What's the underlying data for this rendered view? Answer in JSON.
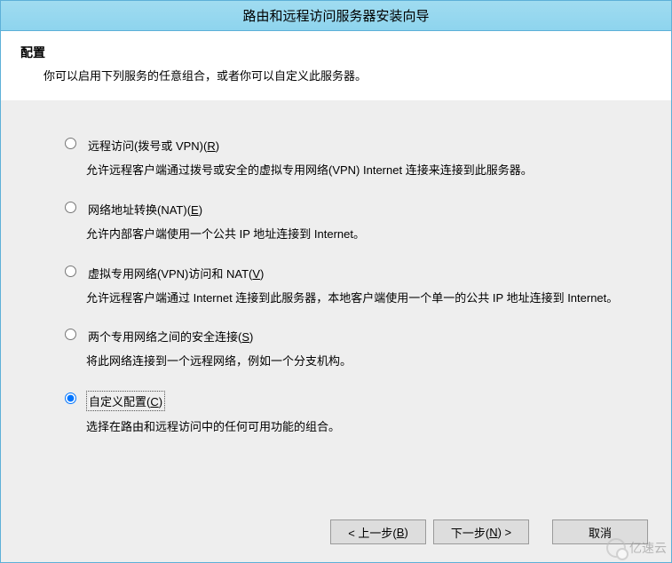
{
  "title": "路由和远程访问服务器安装向导",
  "header": {
    "title": "配置",
    "desc": "你可以启用下列服务的任意组合，或者你可以自定义此服务器。"
  },
  "options": [
    {
      "label_pre": "远程访问(拨号或 VPN)(",
      "hotkey": "R",
      "label_post": ")",
      "desc": "允许远程客户端通过拨号或安全的虚拟专用网络(VPN) Internet 连接来连接到此服务器。",
      "selected": false
    },
    {
      "label_pre": "网络地址转换(NAT)(",
      "hotkey": "E",
      "label_post": ")",
      "desc": "允许内部客户端使用一个公共 IP 地址连接到 Internet。",
      "selected": false
    },
    {
      "label_pre": "虚拟专用网络(VPN)访问和 NAT(",
      "hotkey": "V",
      "label_post": ")",
      "desc": "允许远程客户端通过 Internet 连接到此服务器，本地客户端使用一个单一的公共 IP 地址连接到 Internet。",
      "selected": false
    },
    {
      "label_pre": "两个专用网络之间的安全连接(",
      "hotkey": "S",
      "label_post": ")",
      "desc": "将此网络连接到一个远程网络，例如一个分支机构。",
      "selected": false
    },
    {
      "label_pre": "自定义配置(",
      "hotkey": "C",
      "label_post": ")",
      "desc": "选择在路由和远程访问中的任何可用功能的组合。",
      "selected": true
    }
  ],
  "buttons": {
    "back_pre": "< 上一步(",
    "back_hotkey": "B",
    "back_post": ")",
    "next_pre": "下一步(",
    "next_hotkey": "N",
    "next_post": ") >",
    "cancel": "取消"
  },
  "watermark": "亿速云"
}
